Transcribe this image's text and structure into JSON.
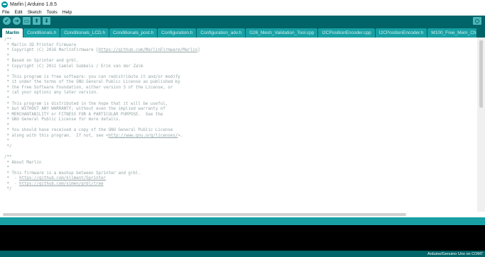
{
  "window": {
    "title": "Marlin | Arduino 1.8.5"
  },
  "menu": [
    "File",
    "Edit",
    "Sketch",
    "Tools",
    "Help"
  ],
  "toolbar": {
    "verify": "✔",
    "upload": "➜",
    "new": "▭",
    "open": "⬆",
    "save": "⬇"
  },
  "tabs": [
    "Marlin",
    "Conditionals.h",
    "Conditionals_LCD.h",
    "Conditionals_post.h",
    "Configuration.h",
    "Configuration_adv.h",
    "G26_Mesh_Validation_Tool.cpp",
    "I2CPositionEncoder.cpp",
    "I2CPositionEncoder.h",
    "M100_Free_Mem_Chk.cpp"
  ],
  "code": [
    "/**",
    " * Marlin 3D Printer Firmware",
    " * Copyright (C) 2016 MarlinFirmware [https://github.com/MarlinFirmware/Marlin]",
    " *",
    " * Based on Sprinter and grbl.",
    " * Copyright (C) 2011 Camiel Gubbels / Erik van der Zalm",
    " *",
    " * This program is free software: you can redistribute it and/or modify",
    " * it under the terms of the GNU General Public License as published by",
    " * the Free Software Foundation, either version 3 of the License, or",
    " * (at your option) any later version.",
    " *",
    " * This program is distributed in the hope that it will be useful,",
    " * but WITHOUT ANY WARRANTY; without even the implied warranty of",
    " * MERCHANTABILITY or FITNESS FOR A PARTICULAR PURPOSE.  See the",
    " * GNU General Public License for more details.",
    " *",
    " * You should have received a copy of the GNU General Public License",
    " * along with this program.  If not, see <http://www.gnu.org/licenses/>.",
    " *",
    " */",
    "",
    "/**",
    " * About Marlin",
    " *",
    " * This firmware is a mashup between Sprinter and grbl.",
    " *  - https://github.com/kliment/Sprinter",
    " *  - https://github.com/simen/grbl/tree",
    " */",
    ""
  ],
  "status": {
    "board_port": "Arduino/Genuino Uno on COM7"
  }
}
